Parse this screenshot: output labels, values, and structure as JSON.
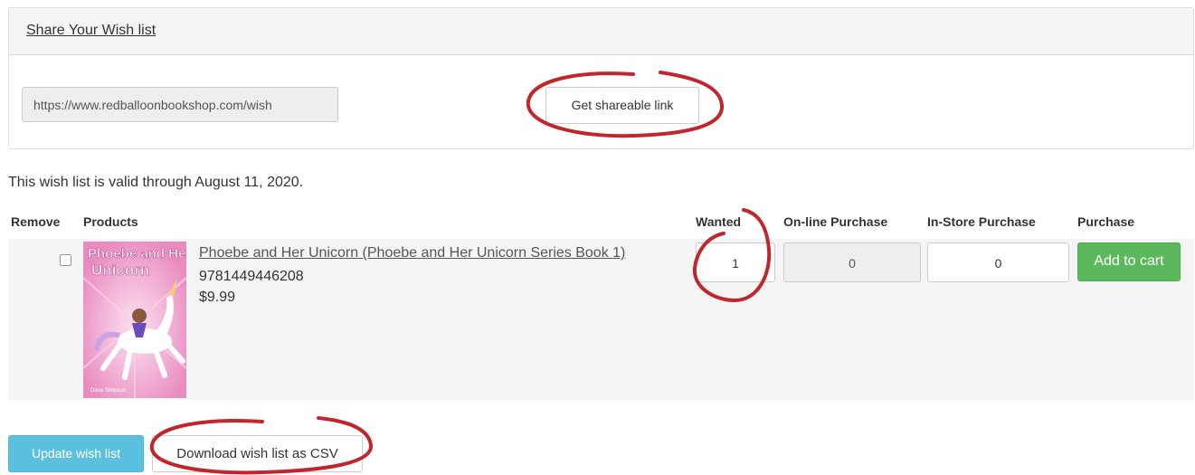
{
  "share_panel": {
    "title": "Share Your Wish list",
    "url_value": "https://www.redballoonbookshop.com/wish",
    "share_button_label": "Get shareable link"
  },
  "validity_text": "This wish list is valid through August 11, 2020.",
  "table": {
    "headers": {
      "remove": "Remove",
      "products": "Products",
      "wanted": "Wanted",
      "online": "On-line Purchase",
      "instore": "In-Store Purchase",
      "purchase": "Purchase"
    },
    "rows": [
      {
        "checked": false,
        "title": "Phoebe and Her Unicorn (Phoebe and Her Unicorn Series Book 1)",
        "isbn": "9781449446208",
        "price": "$9.99",
        "cover_text": [
          "Phoebe and Her",
          "Unicorn",
          "Dana Simpson"
        ],
        "wanted": "1",
        "online": "0",
        "instore": "0",
        "add_to_cart_label": "Add to cart"
      }
    ]
  },
  "actions": {
    "update_label": "Update wish list",
    "csv_label": "Download wish list as CSV"
  },
  "colors": {
    "annotation": "#c0272d",
    "success": "#5cb85c",
    "info": "#5bc0de",
    "cover": "#f2a6cf"
  }
}
